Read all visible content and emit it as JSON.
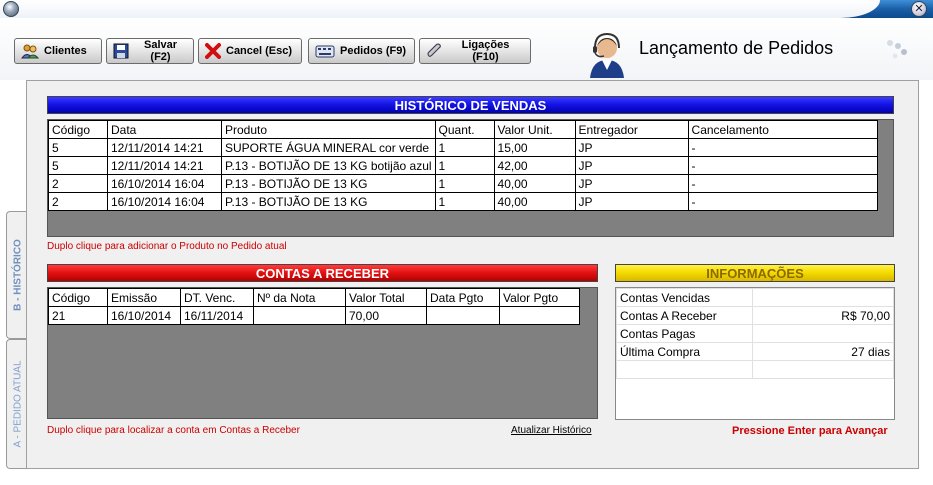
{
  "toolbar": {
    "buttons": {
      "clientes": "Clientes",
      "salvar": "Salvar (F2)",
      "cancel": "Cancel (Esc)",
      "pedidos": "Pedidos (F9)",
      "ligacoes": "Ligações (F10)"
    },
    "title": "Lançamento de Pedidos"
  },
  "tabs": {
    "historico": "B - HISTÓRICO",
    "pedido_atual": "A - PEDIDO ATUAL"
  },
  "historico": {
    "title": "HISTÓRICO DE VENDAS",
    "columns": [
      "Código",
      "Data",
      "Produto",
      "Quant.",
      "Valor Unit.",
      "Entregador",
      "Cancelamento"
    ],
    "rows": [
      [
        "5",
        "12/11/2014 14:21",
        "SUPORTE ÁGUA MINERAL cor verde",
        "1",
        "15,00",
        "JP",
        "-"
      ],
      [
        "5",
        "12/11/2014 14:21",
        "P.13 - BOTIJÃO DE 13 KG botijão azul",
        "1",
        "42,00",
        "JP",
        "-"
      ],
      [
        "2",
        "16/10/2014 16:04",
        "P.13 - BOTIJÃO DE 13 KG",
        "1",
        "40,00",
        "JP",
        "-"
      ],
      [
        "2",
        "16/10/2014 16:04",
        "P.13 - BOTIJÃO DE 13 KG",
        "1",
        "40,00",
        "JP",
        "-"
      ]
    ],
    "hint": "Duplo clique para adicionar o Produto no Pedido atual"
  },
  "contas": {
    "title": "CONTAS A RECEBER",
    "columns": [
      "Código",
      "Emissão",
      "DT. Venc.",
      "Nº da Nota",
      "Valor Total",
      "Data Pgto",
      "Valor Pgto"
    ],
    "rows": [
      [
        "21",
        "16/10/2014",
        "16/11/2014",
        "",
        "70,00",
        "",
        ""
      ]
    ],
    "hint": "Duplo clique para localizar a conta em Contas a Receber",
    "atualizar": "Atualizar Histórico"
  },
  "informacoes": {
    "title": "INFORMAÇÕES",
    "rows": [
      {
        "label": "Contas Vencidas",
        "value": ""
      },
      {
        "label": "Contas A Receber",
        "value": "R$ 70,00"
      },
      {
        "label": "Contas Pagas",
        "value": ""
      },
      {
        "label": "Última Compra",
        "value": "27 dias"
      },
      {
        "label": "",
        "value": ""
      }
    ],
    "advance": "Pressione Enter para Avançar"
  },
  "colors": {
    "historico_header": "#1414e6",
    "contas_header": "#e61414",
    "info_header": "#f5dc00",
    "hint_red": "#cc0000"
  }
}
